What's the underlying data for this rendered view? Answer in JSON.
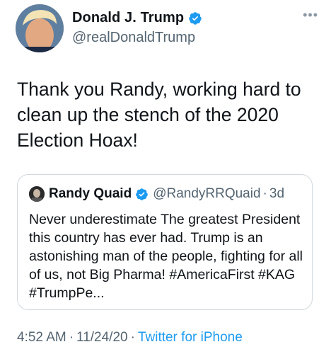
{
  "tweet": {
    "author_name": "Donald J. Trump",
    "author_handle": "@realDonaldTrump",
    "more_icon": "more-icon",
    "text": "Thank you Randy, working hard to clean up the stench of the 2020 Election Hoax!",
    "time": "4:52 AM",
    "date": "11/24/20",
    "separator": "·",
    "source": "Twitter for iPhone"
  },
  "quote": {
    "author_name": "Randy Quaid",
    "author_handle": "@RandyRRQuaid",
    "separator": "·",
    "age": "3d",
    "text": "Never underestimate The greatest President this country has ever had. Trump is an astonishing man of the people, fighting for all of us, not Big Pharma! #AmericaFirst #KAG #TrumpPe..."
  },
  "colors": {
    "verified_badge": "#1d9bf0",
    "link": "#1d9bf0",
    "secondary_text": "#536471",
    "quote_border": "#cfd9de"
  }
}
